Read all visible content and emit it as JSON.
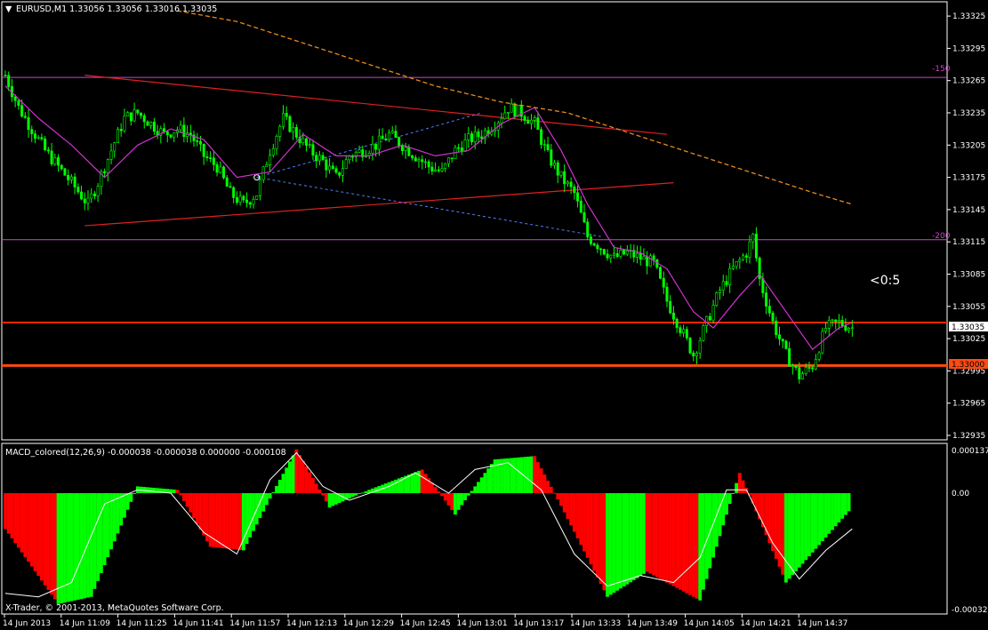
{
  "colors": {
    "background": "#000000",
    "frame": "#ffffff",
    "grid": "#2a2a2a",
    "candle": "#00ff00",
    "ma_fast": "#cc33cc",
    "ma_slow": "#e88a1a",
    "trendline": "#e02020",
    "dotted": "#4f7fff",
    "level_magenta": "#cc44cc",
    "level_red": "#ff2a00",
    "level_orange": "#ff4a10",
    "macd_up": "#00ff00",
    "macd_down": "#ff0000",
    "signal": "#ffffff"
  },
  "header": {
    "symbol_label": "EURUSD,M1  1.33056 1.33056 1.33016 1.33035"
  },
  "annotation": {
    "text": "<0:5"
  },
  "levels": [
    {
      "label": "-150",
      "price": 1.33268
    },
    {
      "label": "-200",
      "price": 1.33117
    }
  ],
  "price_scale": {
    "ticks": [
      "1.33325",
      "1.33295",
      "1.33265",
      "1.33235",
      "1.33205",
      "1.33175",
      "1.33145",
      "1.33115",
      "1.33085",
      "1.33055",
      "1.33025",
      "1.32995",
      "1.32965",
      "1.32935"
    ],
    "current_price": "1.33035",
    "marked_price": "1.33000"
  },
  "macd": {
    "label": "MACD_colored(12,26,9) -0.000038 -0.000038 0.000000 -0.000108",
    "scale_top": "0.000137",
    "scale_zero": "0.00",
    "scale_bottom": "-0.000328"
  },
  "time_axis": {
    "labels": [
      "14 Jun 2013",
      "14 Jun 11:09",
      "14 Jun 11:25",
      "14 Jun 11:41",
      "14 Jun 11:57",
      "14 Jun 12:13",
      "14 Jun 12:29",
      "14 Jun 12:45",
      "14 Jun 13:01",
      "14 Jun 13:17",
      "14 Jun 13:33",
      "14 Jun 13:49",
      "14 Jun 14:05",
      "14 Jun 14:21",
      "14 Jun 14:37"
    ]
  },
  "copyright": "X-Trader, © 2001-2013, MetaQuotes Software Corp.",
  "chart_data": {
    "type": "candlestick",
    "symbol": "EURUSD",
    "timeframe": "M1",
    "price_range": [
      1.32935,
      1.33335
    ],
    "close_path": [
      [
        0,
        1.3327
      ],
      [
        4,
        1.3324
      ],
      [
        8,
        1.3322
      ],
      [
        12,
        1.332
      ],
      [
        16,
        1.33185
      ],
      [
        20,
        1.3317
      ],
      [
        25,
        1.3315
      ],
      [
        28,
        1.3317
      ],
      [
        32,
        1.332
      ],
      [
        36,
        1.3323
      ],
      [
        40,
        1.33235
      ],
      [
        44,
        1.33225
      ],
      [
        48,
        1.33215
      ],
      [
        52,
        1.3322
      ],
      [
        56,
        1.33215
      ],
      [
        60,
        1.33195
      ],
      [
        64,
        1.33185
      ],
      [
        68,
        1.3316
      ],
      [
        72,
        1.3315
      ],
      [
        76,
        1.3316
      ],
      [
        80,
        1.332
      ],
      [
        84,
        1.3323
      ],
      [
        88,
        1.33215
      ],
      [
        92,
        1.332
      ],
      [
        96,
        1.3319
      ],
      [
        100,
        1.33175
      ],
      [
        104,
        1.33195
      ],
      [
        108,
        1.332
      ],
      [
        112,
        1.33205
      ],
      [
        116,
        1.33215
      ],
      [
        120,
        1.33205
      ],
      [
        124,
        1.33195
      ],
      [
        128,
        1.33185
      ],
      [
        132,
        1.3318
      ],
      [
        136,
        1.332
      ],
      [
        140,
        1.3321
      ],
      [
        144,
        1.33215
      ],
      [
        148,
        1.33225
      ],
      [
        152,
        1.3324
      ],
      [
        156,
        1.33235
      ],
      [
        160,
        1.33225
      ],
      [
        164,
        1.33195
      ],
      [
        168,
        1.33175
      ],
      [
        172,
        1.3316
      ],
      [
        176,
        1.3312
      ],
      [
        180,
        1.3311
      ],
      [
        184,
        1.331
      ],
      [
        188,
        1.33105
      ],
      [
        192,
        1.331
      ],
      [
        196,
        1.33095
      ],
      [
        200,
        1.3306
      ],
      [
        204,
        1.33035
      ],
      [
        208,
        1.3301
      ],
      [
        212,
        1.3304
      ],
      [
        216,
        1.3307
      ],
      [
        220,
        1.3309
      ],
      [
        224,
        1.33105
      ],
      [
        226,
        1.3312
      ],
      [
        228,
        1.3308
      ],
      [
        232,
        1.3304
      ],
      [
        236,
        1.3301
      ],
      [
        240,
        1.3299
      ],
      [
        244,
        1.33
      ],
      [
        248,
        1.33035
      ],
      [
        252,
        1.3304
      ],
      [
        256,
        1.33035
      ]
    ],
    "ma_fast": [
      [
        0,
        1.3326
      ],
      [
        10,
        1.3323
      ],
      [
        20,
        1.33205
      ],
      [
        30,
        1.33175
      ],
      [
        40,
        1.33205
      ],
      [
        50,
        1.3322
      ],
      [
        60,
        1.3321
      ],
      [
        70,
        1.33175
      ],
      [
        80,
        1.3318
      ],
      [
        90,
        1.33215
      ],
      [
        100,
        1.33195
      ],
      [
        110,
        1.33195
      ],
      [
        120,
        1.33205
      ],
      [
        130,
        1.33195
      ],
      [
        140,
        1.332
      ],
      [
        150,
        1.33225
      ],
      [
        160,
        1.3324
      ],
      [
        168,
        1.332
      ],
      [
        176,
        1.3315
      ],
      [
        184,
        1.3311
      ],
      [
        192,
        1.33105
      ],
      [
        200,
        1.3309
      ],
      [
        208,
        1.3305
      ],
      [
        214,
        1.33035
      ],
      [
        222,
        1.33065
      ],
      [
        228,
        1.33085
      ],
      [
        236,
        1.3305
      ],
      [
        244,
        1.33015
      ],
      [
        252,
        1.33035
      ],
      [
        256,
        1.3304
      ]
    ],
    "ma_slow": [
      [
        52,
        1.3333
      ],
      [
        70,
        1.3332
      ],
      [
        90,
        1.333
      ],
      [
        110,
        1.3328
      ],
      [
        130,
        1.3326
      ],
      [
        150,
        1.33245
      ],
      [
        170,
        1.33235
      ],
      [
        190,
        1.33215
      ],
      [
        210,
        1.33195
      ],
      [
        230,
        1.33175
      ],
      [
        245,
        1.3316
      ],
      [
        256,
        1.3315
      ]
    ],
    "macd_hist": {
      "zero": 0,
      "max": 0.000137,
      "min": -0.000328,
      "segments": [
        {
          "from": 0,
          "to": 16,
          "start": -0.0001,
          "end": -0.00031,
          "up": false
        },
        {
          "from": 16,
          "to": 26,
          "start": -0.00031,
          "end": -0.00029,
          "up": true
        },
        {
          "from": 26,
          "to": 40,
          "start": -0.00029,
          "end": 2e-05,
          "up": true
        },
        {
          "from": 40,
          "to": 52,
          "start": 2e-05,
          "end": 1e-05,
          "up": true
        },
        {
          "from": 52,
          "to": 62,
          "start": 1e-05,
          "end": -0.00015,
          "up": false
        },
        {
          "from": 62,
          "to": 72,
          "start": -0.00015,
          "end": -0.00016,
          "up": false
        },
        {
          "from": 72,
          "to": 88,
          "start": -0.00016,
          "end": 0.00013,
          "up": true
        },
        {
          "from": 88,
          "to": 98,
          "start": 0.00013,
          "end": -4e-05,
          "up": false
        },
        {
          "from": 98,
          "to": 110,
          "start": -4e-05,
          "end": 1e-05,
          "up": true
        },
        {
          "from": 110,
          "to": 126,
          "start": 1e-05,
          "end": 7e-05,
          "up": true
        },
        {
          "from": 126,
          "to": 136,
          "start": 7e-05,
          "end": -6e-05,
          "up": false
        },
        {
          "from": 136,
          "to": 148,
          "start": -6e-05,
          "end": 0.0001,
          "up": true
        },
        {
          "from": 148,
          "to": 160,
          "start": 0.0001,
          "end": 0.00011,
          "up": true
        },
        {
          "from": 160,
          "to": 182,
          "start": 0.00011,
          "end": -0.00029,
          "up": false
        },
        {
          "from": 182,
          "to": 194,
          "start": -0.00029,
          "end": -0.00022,
          "up": true
        },
        {
          "from": 194,
          "to": 210,
          "start": -0.00022,
          "end": -0.0003,
          "up": false
        },
        {
          "from": 210,
          "to": 222,
          "start": -0.0003,
          "end": 6e-05,
          "up": true
        },
        {
          "from": 222,
          "to": 236,
          "start": 6e-05,
          "end": -0.00025,
          "up": false
        },
        {
          "from": 236,
          "to": 256,
          "start": -0.00025,
          "end": -4e-05,
          "up": true
        }
      ]
    },
    "macd_signal": [
      [
        0,
        -0.00028
      ],
      [
        10,
        -0.00029
      ],
      [
        20,
        -0.00025
      ],
      [
        30,
        -3e-05
      ],
      [
        40,
        1e-05
      ],
      [
        50,
        0.0
      ],
      [
        60,
        -0.00011
      ],
      [
        70,
        -0.00017
      ],
      [
        80,
        4e-05
      ],
      [
        88,
        0.00012
      ],
      [
        96,
        2e-05
      ],
      [
        104,
        -2e-05
      ],
      [
        116,
        2e-05
      ],
      [
        124,
        6e-05
      ],
      [
        134,
        0.0
      ],
      [
        142,
        7e-05
      ],
      [
        152,
        9e-05
      ],
      [
        162,
        1e-05
      ],
      [
        172,
        -0.00017
      ],
      [
        182,
        -0.00026
      ],
      [
        192,
        -0.00023
      ],
      [
        202,
        -0.00025
      ],
      [
        210,
        -0.00018
      ],
      [
        218,
        1e-05
      ],
      [
        224,
        1e-05
      ],
      [
        232,
        -0.00014
      ],
      [
        240,
        -0.00024
      ],
      [
        248,
        -0.00016
      ],
      [
        256,
        -0.0001
      ]
    ]
  }
}
